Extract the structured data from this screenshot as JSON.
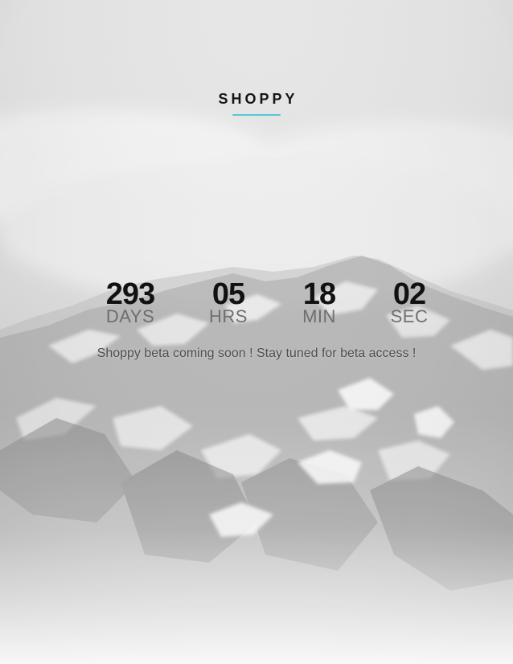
{
  "brand": {
    "title": "SHOPPY"
  },
  "countdown": {
    "days": {
      "value": "293",
      "label": "DAYS"
    },
    "hours": {
      "value": "05",
      "label": "HRS"
    },
    "minutes": {
      "value": "18",
      "label": "MIN"
    },
    "seconds": {
      "value": "02",
      "label": "SEC"
    }
  },
  "tagline": "Shoppy beta coming soon ! Stay tuned for beta access !",
  "colors": {
    "accent_underline": "#58c7d6",
    "text_primary": "#111111",
    "text_secondary": "#6a6a6a",
    "background_fog": "#eeeeee"
  }
}
